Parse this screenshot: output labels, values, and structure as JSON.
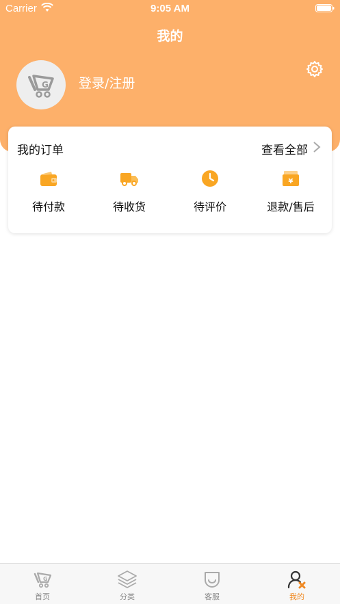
{
  "status_bar": {
    "carrier": "Carrier",
    "time": "9:05 AM"
  },
  "header": {
    "title": "我的",
    "login_text": "登录/注册"
  },
  "orders": {
    "title": "我的订单",
    "view_all": "查看全部",
    "items": [
      {
        "label": "待付款",
        "icon": "wallet-icon"
      },
      {
        "label": "待收货",
        "icon": "delivery-truck-icon"
      },
      {
        "label": "待评价",
        "icon": "clock-icon"
      },
      {
        "label": "退款/售后",
        "icon": "refund-icon"
      }
    ]
  },
  "tab_bar": {
    "tabs": [
      {
        "label": "首页",
        "icon": "home-logo-icon",
        "active": false
      },
      {
        "label": "分类",
        "icon": "layers-icon",
        "active": false
      },
      {
        "label": "客服",
        "icon": "customer-service-icon",
        "active": false
      },
      {
        "label": "我的",
        "icon": "profile-icon",
        "active": true
      }
    ]
  },
  "colors": {
    "accent": "#fdb06a",
    "icon_orange": "#f9a623",
    "tab_active": "#f08a24"
  }
}
